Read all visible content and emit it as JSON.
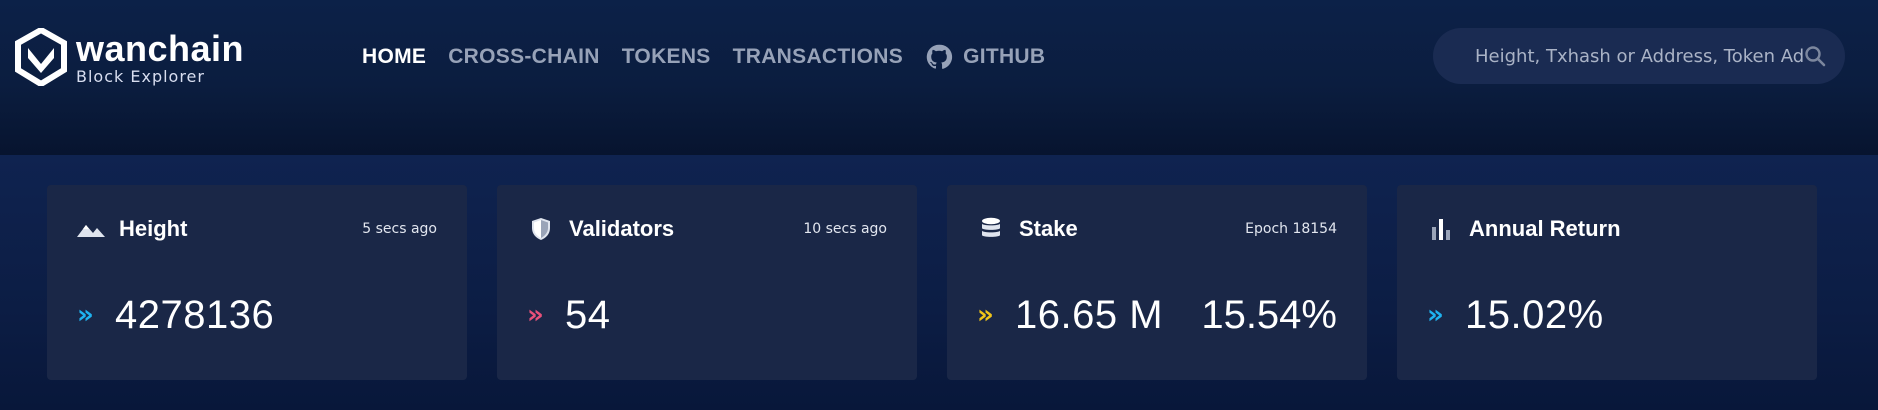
{
  "brand": {
    "name": "wanchain",
    "subtitle": "Block Explorer"
  },
  "nav": {
    "items": [
      {
        "label": "HOME",
        "active": true
      },
      {
        "label": "CROSS-CHAIN",
        "active": false
      },
      {
        "label": "TOKENS",
        "active": false
      },
      {
        "label": "TRANSACTIONS",
        "active": false
      },
      {
        "label": "GITHUB",
        "active": false,
        "icon": "github-icon"
      }
    ]
  },
  "search": {
    "placeholder": "Height, Txhash or Address, Token Address",
    "icon": "search-icon"
  },
  "cards": [
    {
      "title": "Height",
      "meta": "5 secs ago",
      "value": "4278136",
      "icon": "mountain-icon",
      "chevron_color": "#1eb3f0"
    },
    {
      "title": "Validators",
      "meta": "10 secs ago",
      "value": "54",
      "icon": "shield-icon",
      "chevron_color": "#e8507a"
    },
    {
      "title": "Stake",
      "meta": "Epoch 18154",
      "value": "16.65 M",
      "value_secondary": "15.54%",
      "icon": "database-icon",
      "chevron_color": "#f0c419"
    },
    {
      "title": "Annual Return",
      "meta": "",
      "value": "15.02%",
      "icon": "bar-chart-icon",
      "chevron_color": "#1eb3f0"
    }
  ],
  "colors": {
    "header_bg": "#0b1d3f",
    "card_bg": "#1a2747",
    "nav_active": "#ffffff",
    "nav_inactive": "#97a2b8"
  }
}
